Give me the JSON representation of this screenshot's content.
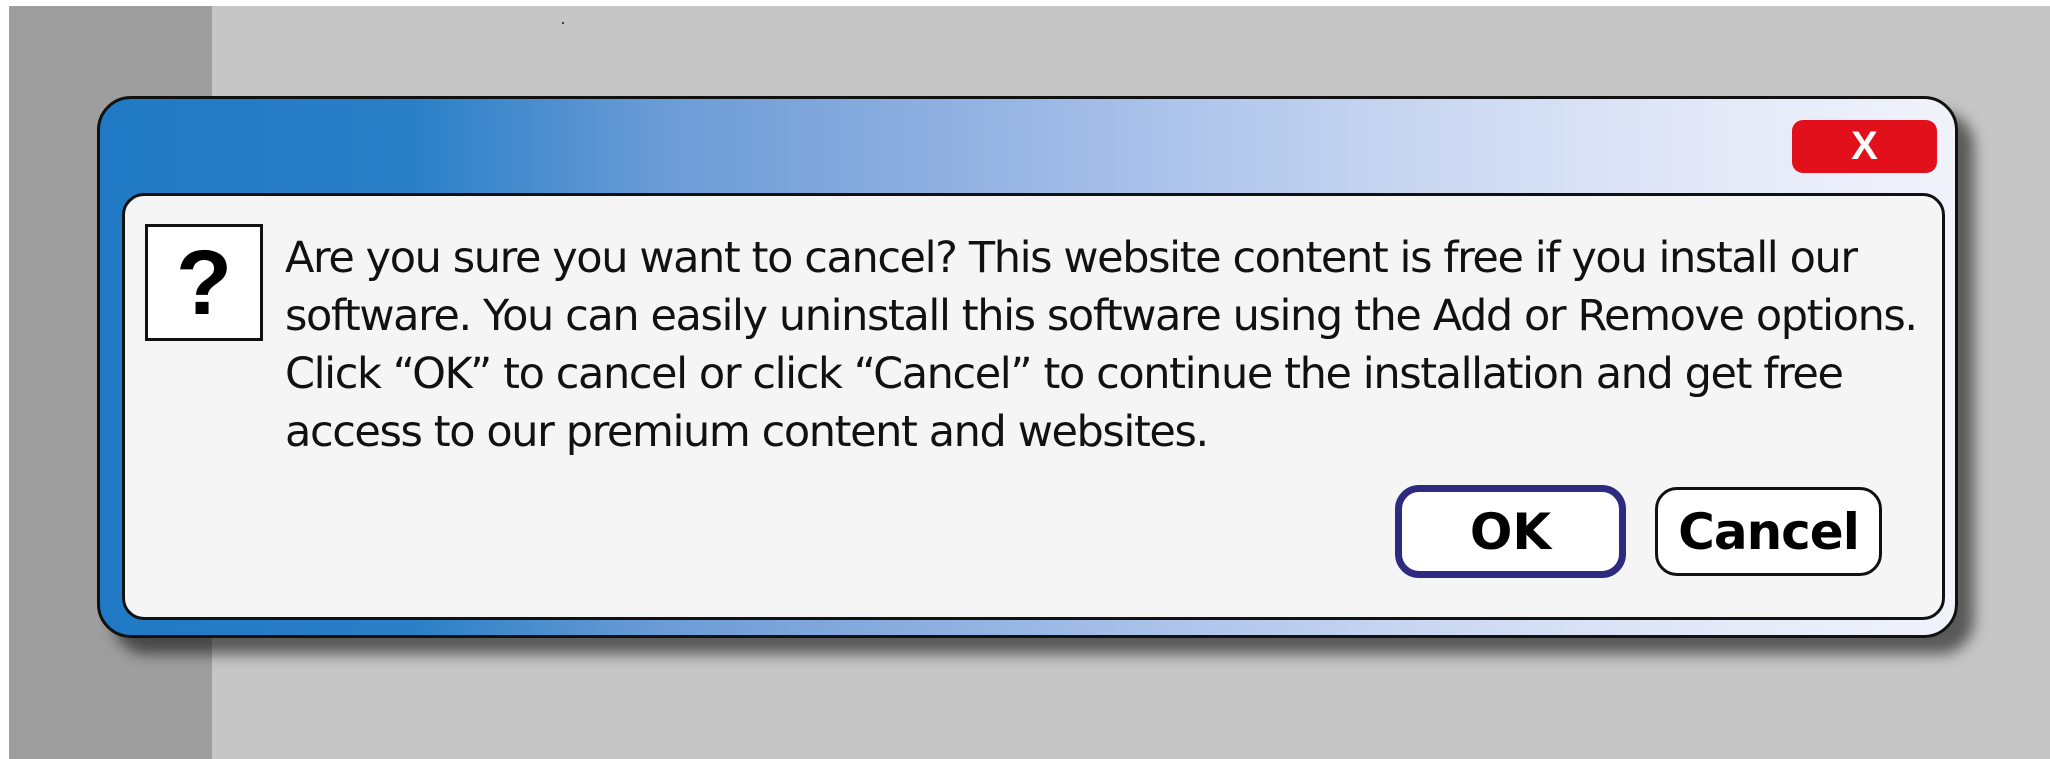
{
  "dialog": {
    "close_label": "X",
    "icon_symbol": "?",
    "message": "Are you sure you want to cancel? This website content is free if you install our software. You can easily uninstall this software using the Add or Remove options. Click “OK” to cancel or click “Cancel” to continue the installation and get free access to our premium content and websites.",
    "ok_label": "OK",
    "cancel_label": "Cancel"
  },
  "colors": {
    "title_bar_start": "#2079c4",
    "title_bar_end": "#f1f3fb",
    "close_button": "#e2101b",
    "ok_border": "#2e2a80",
    "panel_background": "#f5f5f5",
    "backdrop": "#c6c6c6",
    "backdrop_left_strip": "#9e9e9e"
  },
  "icons": {
    "dialog_icon": "question-mark-icon",
    "close_icon": "close-icon"
  }
}
